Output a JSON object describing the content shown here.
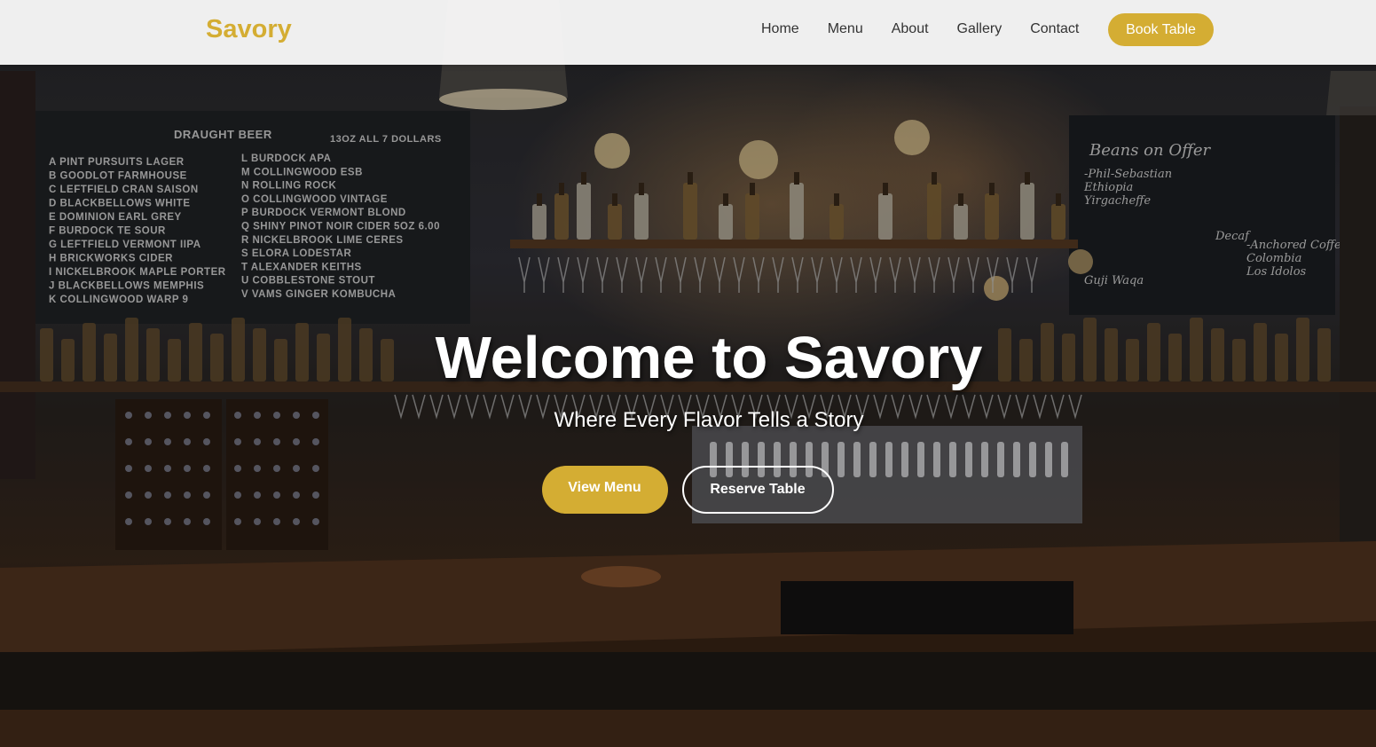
{
  "navbar": {
    "brand": "Savory",
    "links": [
      {
        "label": "Home"
      },
      {
        "label": "Menu"
      },
      {
        "label": "About"
      },
      {
        "label": "Gallery"
      },
      {
        "label": "Contact"
      }
    ],
    "cta_label": "Book Table"
  },
  "hero": {
    "title": "Welcome to Savory",
    "subtitle": "Where Every Flavor Tells a Story",
    "primary_button": "View Menu",
    "secondary_button": "Reserve Table",
    "background": {
      "chalkboard_left": {
        "heading": "DRAUGHT  BEER",
        "subheading": "13OZ   ALL 7 DOLLARS",
        "rows_left": [
          "A PINT PURSUITS LAGER",
          "B GOODLOT  FARMHOUSE",
          "C LEFTFIELD CRAN SAISON",
          "D BLACKBELLOWS WHITE",
          "E DOMINION EARL GREY",
          "F BURDOCK TE SOUR",
          "G LEFTFIELD VERMONT IIPA",
          "H BRICKWORKS CIDER",
          "I NICKELBROOK MAPLE PORTER",
          "J BLACKBELLOWS MEMPHIS",
          "K COLLINGWOOD WARP 9"
        ],
        "rows_right": [
          "L BURDOCK APA",
          "M COLLINGWOOD ESB",
          "N ROLLING ROCK",
          "O COLLINGWOOD VINTAGE",
          "P BURDOCK VERMONT BLOND",
          "Q SHINY PINOT NOIR CIDER 5OZ  6.00",
          "R NICKELBROOK LIME CERES",
          "S ELORA LODESTAR",
          "T ALEXANDER KEITHS",
          "U COBBLESTONE STOUT",
          "V VAMS GINGER KOMBUCHA"
        ]
      },
      "chalkboard_right": {
        "heading": "Beans on Offer",
        "lines": [
          "-Phil-Sebastian",
          "Ethiopia",
          "Yirgacheffe",
          "Decaf",
          "-Anchored Coffee",
          "Colombia",
          "Los Idolos",
          "Guji Waqa"
        ]
      }
    }
  },
  "colors": {
    "accent": "#d4ad33",
    "nav_bg": "#ffffff",
    "nav_text": "#333333",
    "hero_text": "#ffffff"
  }
}
